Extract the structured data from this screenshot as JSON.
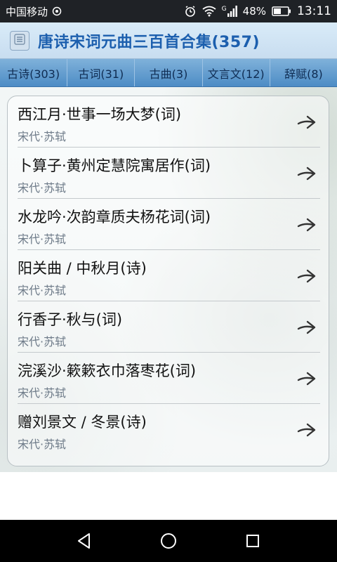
{
  "status_bar": {
    "carrier": "中国移动",
    "battery_percent": "48%",
    "time": "13:11",
    "signal_label": "G"
  },
  "header": {
    "title": "唐诗宋词元曲三百首合集(357)"
  },
  "tabs": [
    {
      "label": "古诗(303)"
    },
    {
      "label": "古词(31)"
    },
    {
      "label": "古曲(3)"
    },
    {
      "label": "文言文(12)"
    },
    {
      "label": "辞赋(8)"
    }
  ],
  "poems": [
    {
      "title": "西江月·世事一场大梦(词)",
      "author": "宋代·苏轼"
    },
    {
      "title": "卜算子·黄州定慧院寓居作(词)",
      "author": "宋代·苏轼"
    },
    {
      "title": "水龙吟·次韵章质夫杨花词(词)",
      "author": "宋代·苏轼"
    },
    {
      "title": "阳关曲 / 中秋月(诗)",
      "author": "宋代·苏轼"
    },
    {
      "title": "行香子·秋与(词)",
      "author": "宋代·苏轼"
    },
    {
      "title": "浣溪沙·簌簌衣巾落枣花(词)",
      "author": "宋代·苏轼"
    },
    {
      "title": "赠刘景文 / 冬景(诗)",
      "author": "宋代·苏轼"
    }
  ],
  "icons": {
    "menu": "menu-icon",
    "item_arrow": "arrow-right-icon",
    "nav_back": "back-triangle-icon",
    "nav_home": "home-circle-icon",
    "nav_recent": "recent-square-icon"
  },
  "colors": {
    "title_blue": "#1c5fae",
    "tab_bar": "#4d8cc5",
    "author_gray": "#6d7a88"
  }
}
